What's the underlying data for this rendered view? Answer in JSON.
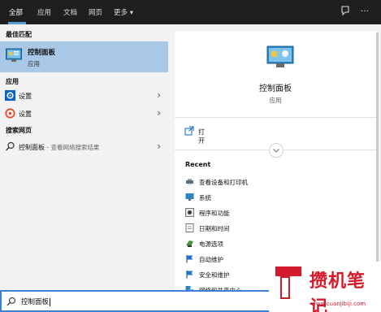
{
  "topbar": {
    "tabs": [
      "全部",
      "应用",
      "文档",
      "网页",
      "更多"
    ],
    "more_arrow": "▾",
    "icons": [
      "feedback-icon",
      "more-icon"
    ],
    "more_dots": "···"
  },
  "left": {
    "best_match_heading": "最佳匹配",
    "best_match": {
      "title": "控制面板",
      "subtitle": "应用",
      "icon": "control-panel-icon"
    },
    "apps_heading": "应用",
    "apps": [
      {
        "label": "设置",
        "icon": "settings-gear-icon",
        "chevron": "›"
      },
      {
        "label": "设置",
        "icon": "settings-app-icon",
        "chevron": "›"
      }
    ],
    "web_heading": "搜索网页",
    "web": {
      "query": "控制面板",
      "hint": " - 查看网络搜索结果",
      "icon": "search-icon",
      "chevron": "›"
    }
  },
  "right": {
    "title": "控制面板",
    "subtitle": "应用",
    "open_label": "打开",
    "recent_heading": "Recent",
    "recent": [
      {
        "label": "查看设备和打印机",
        "icon": "devices-printers-icon"
      },
      {
        "label": "系统",
        "icon": "system-icon"
      },
      {
        "label": "程序和功能",
        "icon": "programs-features-icon"
      },
      {
        "label": "日期和时间",
        "icon": "date-time-icon"
      },
      {
        "label": "电源选项",
        "icon": "power-options-icon"
      },
      {
        "label": "自动维护",
        "icon": "flag-icon"
      },
      {
        "label": "安全和维护",
        "icon": "flag-icon"
      },
      {
        "label": "网络和共享中心",
        "icon": "network-icon"
      }
    ]
  },
  "search": {
    "value": "控制面板",
    "icon": "search-icon"
  },
  "watermark": {
    "text": "攒机笔记",
    "url": "www.cuanjibiji.com"
  },
  "colors": {
    "topbar": "#1f1f1f",
    "selected": "#a9c8e8",
    "accent": "#3b82d6",
    "watermark": "#d41b2c"
  }
}
